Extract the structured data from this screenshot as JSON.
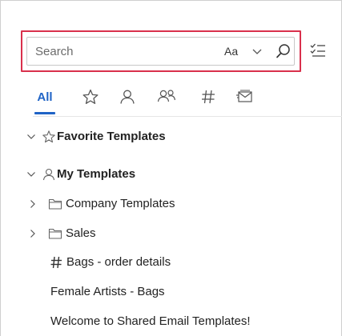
{
  "search": {
    "placeholder": "Search",
    "match_case_label": "Aa"
  },
  "tabs": [
    {
      "label": "All",
      "icon": null,
      "selected": true
    },
    {
      "label": "",
      "icon": "star-icon"
    },
    {
      "label": "",
      "icon": "person-icon"
    },
    {
      "label": "",
      "icon": "people-icon"
    },
    {
      "label": "",
      "icon": "hashtag-icon"
    },
    {
      "label": "",
      "icon": "mailbox-icon"
    }
  ],
  "tree": {
    "favorites": {
      "label": "Favorite Templates",
      "expanded": true
    },
    "my_templates": {
      "label": "My Templates",
      "expanded": true,
      "folders": [
        {
          "label": "Company Templates",
          "expanded": false
        },
        {
          "label": "Sales",
          "expanded": false
        }
      ],
      "items": [
        {
          "label": "Bags - order details",
          "has_hashtag": true
        },
        {
          "label": "Female Artists - Bags",
          "has_hashtag": false
        },
        {
          "label": "Welcome to Shared Email Templates!",
          "has_hashtag": false
        }
      ]
    }
  },
  "colors": {
    "accent": "#1f63c6",
    "highlight_border": "#d9304c"
  }
}
